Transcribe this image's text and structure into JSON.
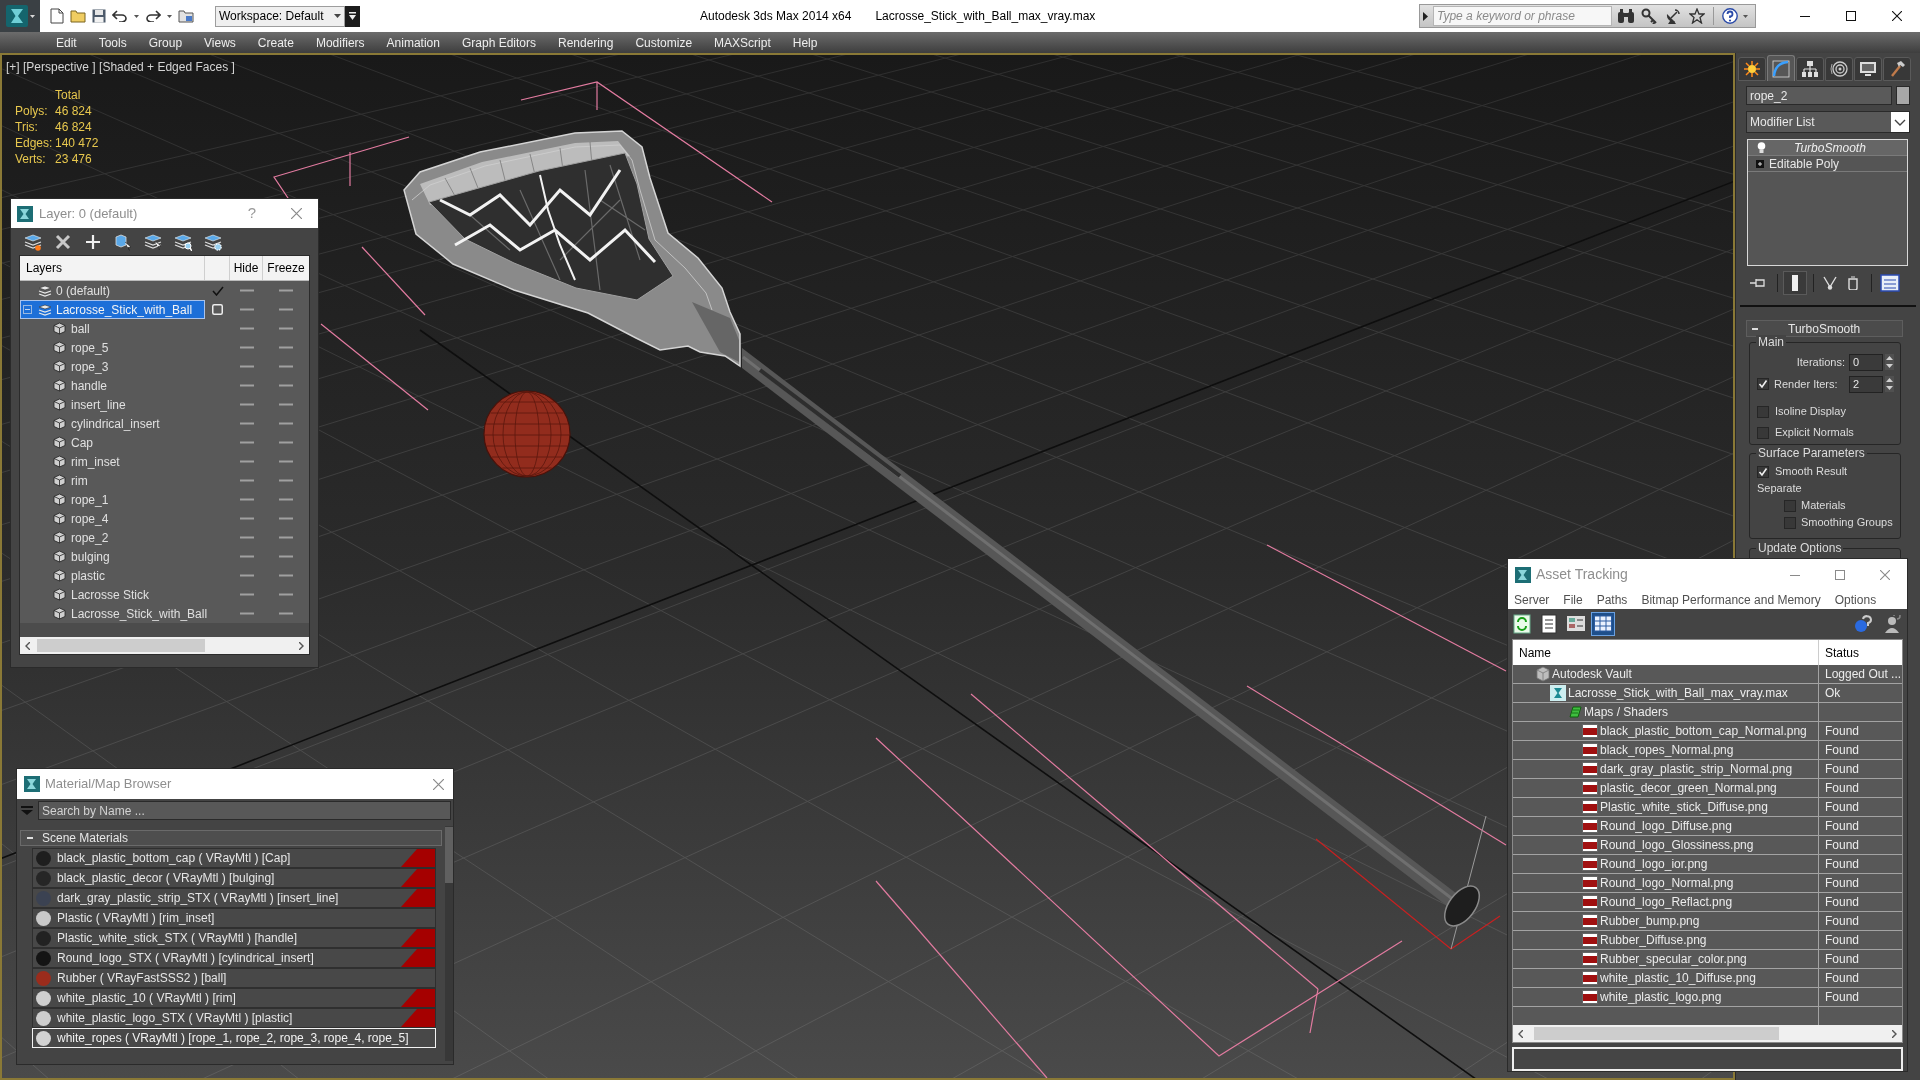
{
  "title_bar": {
    "workspace": "Workspace: Default",
    "app_title": "Autodesk 3ds Max 2014 x64",
    "file_name": "Lacrosse_Stick_with_Ball_max_vray.max",
    "search_placeholder": "Type a keyword or phrase"
  },
  "menu_bar": [
    "Edit",
    "Tools",
    "Group",
    "Views",
    "Create",
    "Modifiers",
    "Animation",
    "Graph Editors",
    "Rendering",
    "Customize",
    "MAXScript",
    "Help"
  ],
  "viewport": {
    "label": "[+] [Perspective ] [Shaded + Edged Faces ]",
    "stats_heading": "Total",
    "stats": [
      {
        "label": "Polys:",
        "value": "46 824"
      },
      {
        "label": "Tris:",
        "value": "46 824"
      },
      {
        "label": "Edges:",
        "value": "140 472"
      },
      {
        "label": "Verts:",
        "value": "23 476"
      }
    ]
  },
  "command_panel": {
    "tabs": [
      {
        "selected": false
      },
      {
        "selected": true
      },
      {
        "selected": false
      },
      {
        "selected": false
      },
      {
        "selected": false
      },
      {
        "selected": false
      }
    ],
    "object_name": "rope_2",
    "modifier_list": "Modifier List",
    "modifier_stack": [
      {
        "kind": "modifier",
        "name": "TurboSmooth",
        "selected": true
      },
      {
        "kind": "base",
        "name": "Editable Poly",
        "selected": false
      }
    ],
    "rollout": {
      "title": "TurboSmooth",
      "expanded": true,
      "groups": [
        {
          "title": "Main",
          "controls": [
            {
              "kind": "spinner",
              "label": "Iterations:",
              "value": "0"
            },
            {
              "kind": "checked_spinner",
              "label": "Render Iters:",
              "value": "2",
              "checked": true
            },
            {
              "kind": "checkbox",
              "label": "Isoline Display",
              "checked": false
            },
            {
              "kind": "checkbox",
              "label": "Explicit Normals",
              "checked": false
            }
          ]
        },
        {
          "title": "Surface Parameters",
          "controls": [
            {
              "kind": "checkbox",
              "label": "Smooth Result",
              "checked": true
            },
            {
              "kind": "label",
              "label": "Separate"
            },
            {
              "kind": "sub_checkbox",
              "label": "Materials",
              "checked": false
            },
            {
              "kind": "sub_checkbox",
              "label": "Smoothing Groups",
              "checked": false
            }
          ]
        },
        {
          "title": "Update Options"
        }
      ]
    }
  },
  "layer_dialog": {
    "title": "Layer: 0 (default)",
    "help_button": "?",
    "columns": [
      "Layers",
      "Hide",
      "Freeze"
    ],
    "layers": [
      {
        "name": "0 (default)",
        "current": true,
        "selected": false,
        "hidden": false,
        "frozen": false
      },
      {
        "name": "Lacrosse_Stick_with_Ball",
        "current": false,
        "selected": true,
        "expanded": true,
        "hidden": false,
        "frozen": false,
        "children": [
          {
            "name": "ball",
            "selected": false,
            "hidden": false,
            "frozen": false
          },
          {
            "name": "rope_5",
            "selected": false,
            "hidden": false,
            "frozen": false
          },
          {
            "name": "rope_3",
            "selected": false,
            "hidden": false,
            "frozen": false
          },
          {
            "name": "handle",
            "selected": false,
            "hidden": false,
            "frozen": false
          },
          {
            "name": "insert_line",
            "selected": false,
            "hidden": false,
            "frozen": false
          },
          {
            "name": "cylindrical_insert",
            "selected": false,
            "hidden": false,
            "frozen": false
          },
          {
            "name": "Cap",
            "selected": false,
            "hidden": false,
            "frozen": false
          },
          {
            "name": "rim_inset",
            "selected": false,
            "hidden": false,
            "frozen": false
          },
          {
            "name": "rim",
            "selected": false,
            "hidden": false,
            "frozen": false
          },
          {
            "name": "rope_1",
            "selected": false,
            "hidden": false,
            "frozen": false
          },
          {
            "name": "rope_4",
            "selected": false,
            "hidden": false,
            "frozen": false
          },
          {
            "name": "rope_2",
            "selected": false,
            "hidden": false,
            "frozen": false
          },
          {
            "name": "bulging",
            "selected": false,
            "hidden": false,
            "frozen": false
          },
          {
            "name": "plastic",
            "selected": false,
            "hidden": false,
            "frozen": false
          },
          {
            "name": "Lacrosse Stick",
            "selected": false,
            "hidden": false,
            "frozen": false
          },
          {
            "name": "Lacrosse_Stick_with_Ball",
            "selected": false,
            "hidden": false,
            "frozen": false
          }
        ]
      }
    ]
  },
  "material_browser": {
    "title": "Material/Map Browser",
    "search_placeholder": "Search by Name ...",
    "group": {
      "title": "Scene Materials",
      "expanded": true,
      "materials": [
        {
          "name": "black_plastic_bottom_cap ( VRayMtl ) [Cap]",
          "color": "#1e1e1e",
          "marked": true,
          "selected": false
        },
        {
          "name": "black_plastic_decor ( VRayMtl ) [bulging]",
          "color": "#262626",
          "marked": true,
          "selected": false
        },
        {
          "name": "dark_gray_plastic_strip_STX ( VRayMtl ) [insert_line]",
          "color": "#3b4252",
          "marked": true,
          "selected": false
        },
        {
          "name": "Plastic ( VRayMtl ) [rim_inset]",
          "color": "#c9c9c9",
          "marked": false,
          "selected": false
        },
        {
          "name": "Plastic_white_stick_STX ( VRayMtl ) [handle]",
          "color": "#222222",
          "marked": true,
          "selected": false
        },
        {
          "name": "Round_logo_STX ( VRayMtl ) [cylindrical_insert]",
          "color": "#141414",
          "marked": true,
          "selected": false
        },
        {
          "name": "Rubber ( VRayFastSSS2 ) [ball]",
          "color": "#9b2c1c",
          "marked": false,
          "selected": false
        },
        {
          "name": "white_plastic_10 ( VRayMtl ) [rim]",
          "color": "#cfcfcf",
          "marked": true,
          "selected": false
        },
        {
          "name": "white_plastic_logo_STX ( VRayMtl ) [plastic]",
          "color": "#cdcdcd",
          "marked": true,
          "selected": false
        },
        {
          "name": "white_ropes ( VRayMtl ) [rope_1, rope_2, rope_3, rope_4, rope_5]",
          "color": "#d2d2d2",
          "marked": false,
          "selected": true
        }
      ]
    }
  },
  "asset_tracking": {
    "title": "Asset Tracking",
    "menu": [
      "Server",
      "File",
      "Paths",
      "Bitmap Performance and Memory",
      "Options"
    ],
    "toolbar": [
      {
        "selected": false
      },
      {
        "selected": false
      },
      {
        "selected": false
      },
      {
        "selected": true
      }
    ],
    "columns": [
      "Name",
      "Status"
    ],
    "assets": [
      {
        "name": "Autodesk Vault",
        "status": "Logged Out ...",
        "selected": false,
        "children": [
          {
            "name": "Lacrosse_Stick_with_Ball_max_vray.max",
            "status": "Ok",
            "selected": false,
            "children": [
              {
                "name": "Maps / Shaders",
                "selected": false,
                "children": [
                  {
                    "name": "black_plastic_bottom_cap_Normal.png",
                    "status": "Found",
                    "selected": false
                  },
                  {
                    "name": "black_ropes_Normal.png",
                    "status": "Found",
                    "selected": false
                  },
                  {
                    "name": "dark_gray_plastic_strip_Normal.png",
                    "status": "Found",
                    "selected": false
                  },
                  {
                    "name": "plastic_decor_green_Normal.png",
                    "status": "Found",
                    "selected": false
                  },
                  {
                    "name": "Plastic_white_stick_Diffuse.png",
                    "status": "Found",
                    "selected": false
                  },
                  {
                    "name": "Round_logo_Diffuse.png",
                    "status": "Found",
                    "selected": false
                  },
                  {
                    "name": "Round_logo_Glossiness.png",
                    "status": "Found",
                    "selected": false
                  },
                  {
                    "name": "Round_logo_ior.png",
                    "status": "Found",
                    "selected": false
                  },
                  {
                    "name": "Round_logo_Normal.png",
                    "status": "Found",
                    "selected": false
                  },
                  {
                    "name": "Round_logo_Reflact.png",
                    "status": "Found",
                    "selected": false
                  },
                  {
                    "name": "Rubber_bump.png",
                    "status": "Found",
                    "selected": false
                  },
                  {
                    "name": "Rubber_Diffuse.png",
                    "status": "Found",
                    "selected": false
                  },
                  {
                    "name": "Rubber_specular_color.png",
                    "status": "Found",
                    "selected": false
                  },
                  {
                    "name": "white_plastic_10_Diffuse.png",
                    "status": "Found",
                    "selected": false
                  },
                  {
                    "name": "white_plastic_logo.png",
                    "status": "Found",
                    "selected": false
                  }
                ]
              }
            ]
          }
        ]
      }
    ]
  }
}
